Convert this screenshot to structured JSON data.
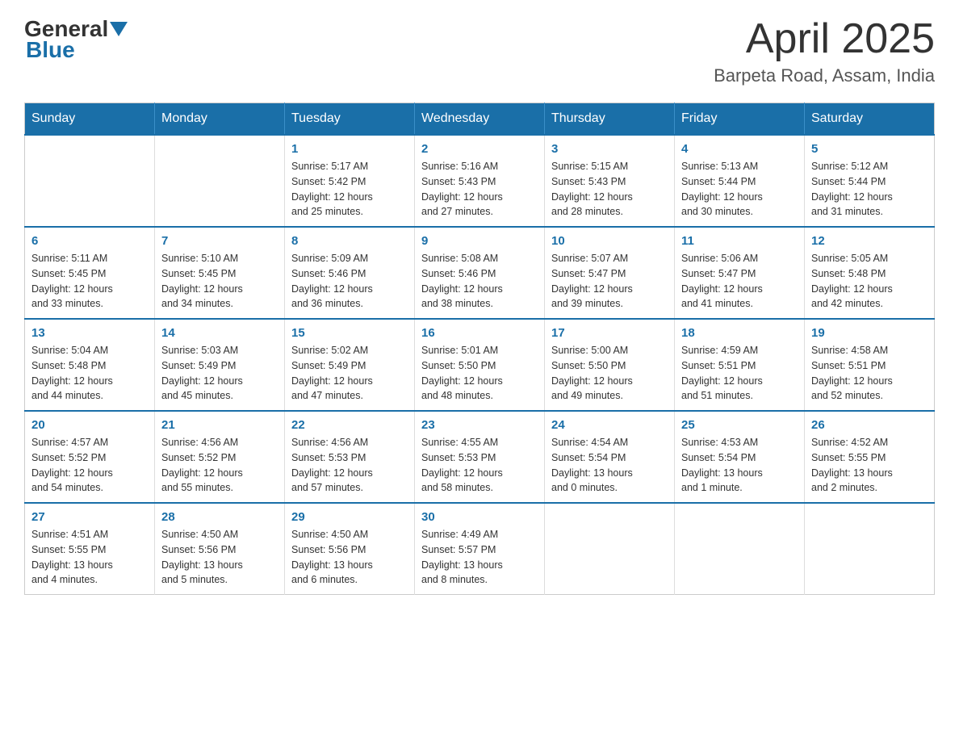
{
  "header": {
    "logo_general": "General",
    "logo_blue": "Blue",
    "month_title": "April 2025",
    "location": "Barpeta Road, Assam, India"
  },
  "days_of_week": [
    "Sunday",
    "Monday",
    "Tuesday",
    "Wednesday",
    "Thursday",
    "Friday",
    "Saturday"
  ],
  "weeks": [
    [
      {
        "day": "",
        "info": ""
      },
      {
        "day": "",
        "info": ""
      },
      {
        "day": "1",
        "info": "Sunrise: 5:17 AM\nSunset: 5:42 PM\nDaylight: 12 hours\nand 25 minutes."
      },
      {
        "day": "2",
        "info": "Sunrise: 5:16 AM\nSunset: 5:43 PM\nDaylight: 12 hours\nand 27 minutes."
      },
      {
        "day": "3",
        "info": "Sunrise: 5:15 AM\nSunset: 5:43 PM\nDaylight: 12 hours\nand 28 minutes."
      },
      {
        "day": "4",
        "info": "Sunrise: 5:13 AM\nSunset: 5:44 PM\nDaylight: 12 hours\nand 30 minutes."
      },
      {
        "day": "5",
        "info": "Sunrise: 5:12 AM\nSunset: 5:44 PM\nDaylight: 12 hours\nand 31 minutes."
      }
    ],
    [
      {
        "day": "6",
        "info": "Sunrise: 5:11 AM\nSunset: 5:45 PM\nDaylight: 12 hours\nand 33 minutes."
      },
      {
        "day": "7",
        "info": "Sunrise: 5:10 AM\nSunset: 5:45 PM\nDaylight: 12 hours\nand 34 minutes."
      },
      {
        "day": "8",
        "info": "Sunrise: 5:09 AM\nSunset: 5:46 PM\nDaylight: 12 hours\nand 36 minutes."
      },
      {
        "day": "9",
        "info": "Sunrise: 5:08 AM\nSunset: 5:46 PM\nDaylight: 12 hours\nand 38 minutes."
      },
      {
        "day": "10",
        "info": "Sunrise: 5:07 AM\nSunset: 5:47 PM\nDaylight: 12 hours\nand 39 minutes."
      },
      {
        "day": "11",
        "info": "Sunrise: 5:06 AM\nSunset: 5:47 PM\nDaylight: 12 hours\nand 41 minutes."
      },
      {
        "day": "12",
        "info": "Sunrise: 5:05 AM\nSunset: 5:48 PM\nDaylight: 12 hours\nand 42 minutes."
      }
    ],
    [
      {
        "day": "13",
        "info": "Sunrise: 5:04 AM\nSunset: 5:48 PM\nDaylight: 12 hours\nand 44 minutes."
      },
      {
        "day": "14",
        "info": "Sunrise: 5:03 AM\nSunset: 5:49 PM\nDaylight: 12 hours\nand 45 minutes."
      },
      {
        "day": "15",
        "info": "Sunrise: 5:02 AM\nSunset: 5:49 PM\nDaylight: 12 hours\nand 47 minutes."
      },
      {
        "day": "16",
        "info": "Sunrise: 5:01 AM\nSunset: 5:50 PM\nDaylight: 12 hours\nand 48 minutes."
      },
      {
        "day": "17",
        "info": "Sunrise: 5:00 AM\nSunset: 5:50 PM\nDaylight: 12 hours\nand 49 minutes."
      },
      {
        "day": "18",
        "info": "Sunrise: 4:59 AM\nSunset: 5:51 PM\nDaylight: 12 hours\nand 51 minutes."
      },
      {
        "day": "19",
        "info": "Sunrise: 4:58 AM\nSunset: 5:51 PM\nDaylight: 12 hours\nand 52 minutes."
      }
    ],
    [
      {
        "day": "20",
        "info": "Sunrise: 4:57 AM\nSunset: 5:52 PM\nDaylight: 12 hours\nand 54 minutes."
      },
      {
        "day": "21",
        "info": "Sunrise: 4:56 AM\nSunset: 5:52 PM\nDaylight: 12 hours\nand 55 minutes."
      },
      {
        "day": "22",
        "info": "Sunrise: 4:56 AM\nSunset: 5:53 PM\nDaylight: 12 hours\nand 57 minutes."
      },
      {
        "day": "23",
        "info": "Sunrise: 4:55 AM\nSunset: 5:53 PM\nDaylight: 12 hours\nand 58 minutes."
      },
      {
        "day": "24",
        "info": "Sunrise: 4:54 AM\nSunset: 5:54 PM\nDaylight: 13 hours\nand 0 minutes."
      },
      {
        "day": "25",
        "info": "Sunrise: 4:53 AM\nSunset: 5:54 PM\nDaylight: 13 hours\nand 1 minute."
      },
      {
        "day": "26",
        "info": "Sunrise: 4:52 AM\nSunset: 5:55 PM\nDaylight: 13 hours\nand 2 minutes."
      }
    ],
    [
      {
        "day": "27",
        "info": "Sunrise: 4:51 AM\nSunset: 5:55 PM\nDaylight: 13 hours\nand 4 minutes."
      },
      {
        "day": "28",
        "info": "Sunrise: 4:50 AM\nSunset: 5:56 PM\nDaylight: 13 hours\nand 5 minutes."
      },
      {
        "day": "29",
        "info": "Sunrise: 4:50 AM\nSunset: 5:56 PM\nDaylight: 13 hours\nand 6 minutes."
      },
      {
        "day": "30",
        "info": "Sunrise: 4:49 AM\nSunset: 5:57 PM\nDaylight: 13 hours\nand 8 minutes."
      },
      {
        "day": "",
        "info": ""
      },
      {
        "day": "",
        "info": ""
      },
      {
        "day": "",
        "info": ""
      }
    ]
  ]
}
